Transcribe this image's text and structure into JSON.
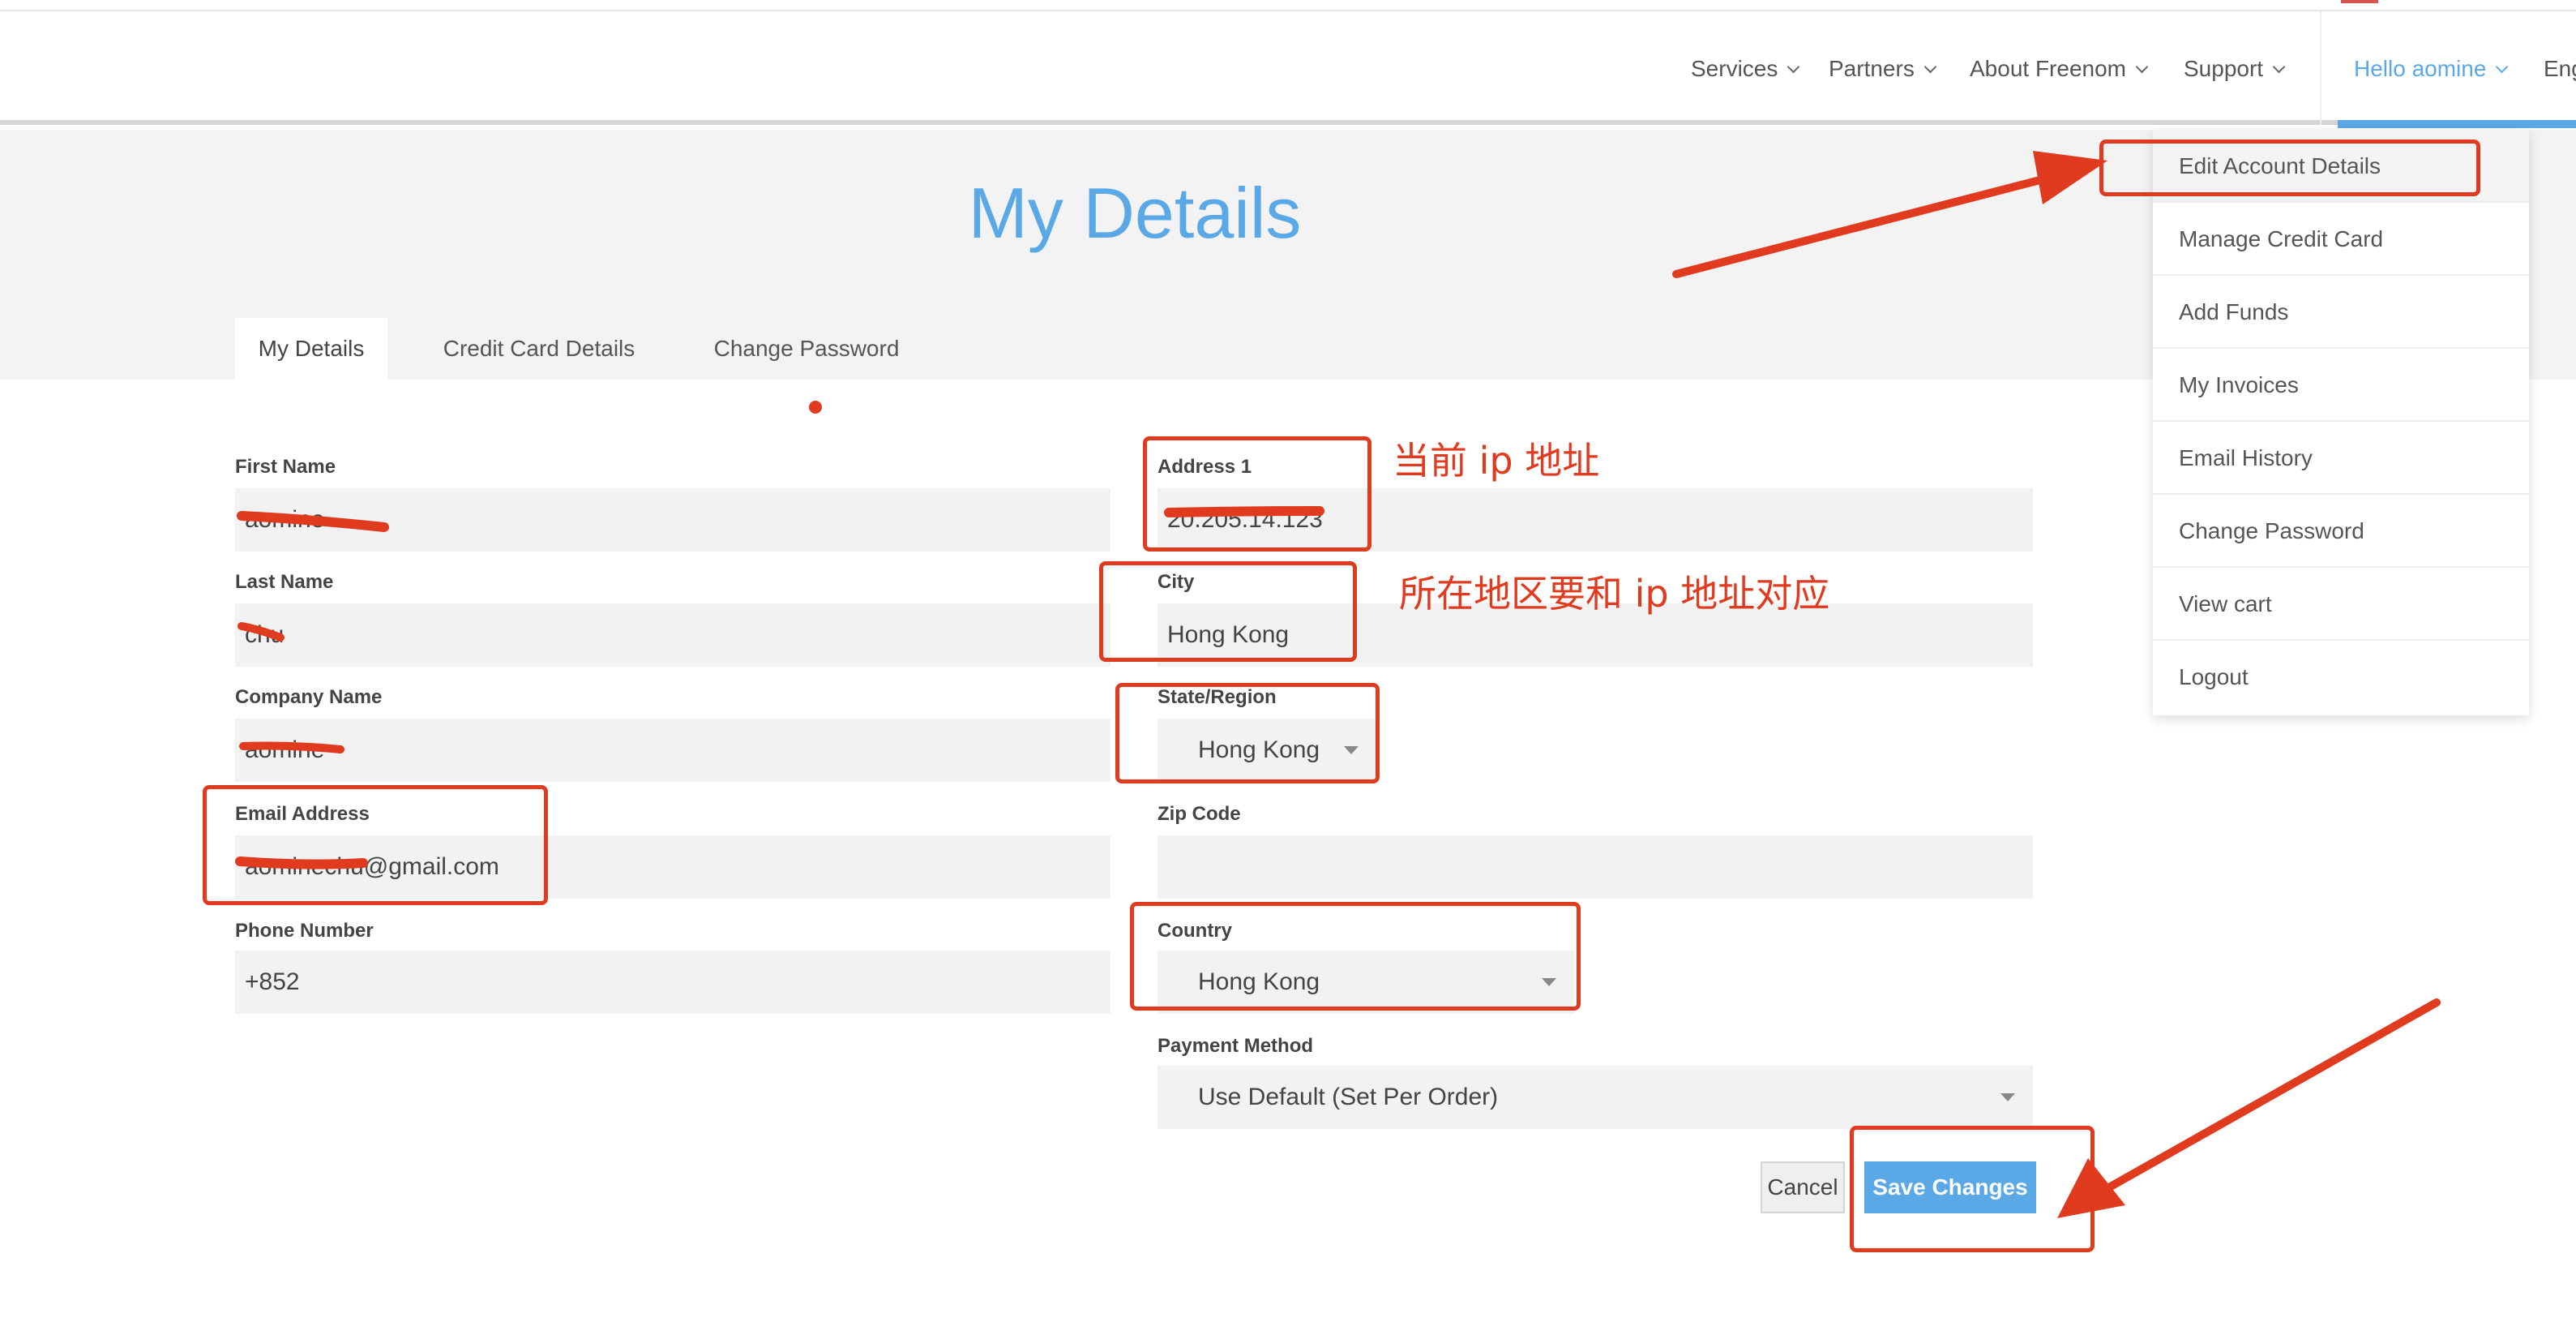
{
  "nav": {
    "services": "Services",
    "partners": "Partners",
    "about": "About Freenom",
    "support": "Support",
    "hello": "Hello aomine",
    "language": "Eng"
  },
  "page": {
    "title": "My Details",
    "tabs": [
      "My Details",
      "Credit Card Details",
      "Change Password"
    ]
  },
  "form": {
    "first_name": {
      "label": "First Name",
      "value": "aomine"
    },
    "last_name": {
      "label": "Last Name",
      "value": "chu"
    },
    "company": {
      "label": "Company Name",
      "value": "aomine"
    },
    "email": {
      "label": "Email Address",
      "value": "aominechu@gmail.com"
    },
    "phone": {
      "label": "Phone Number",
      "value": "+852"
    },
    "address1": {
      "label": "Address 1",
      "value": "20.205.14.123"
    },
    "city": {
      "label": "City",
      "value": "Hong Kong"
    },
    "state": {
      "label": "State/Region",
      "value": "Hong Kong"
    },
    "zip": {
      "label": "Zip Code",
      "value": ""
    },
    "country": {
      "label": "Country",
      "value": "Hong Kong"
    },
    "payment": {
      "label": "Payment Method",
      "value": "Use Default (Set Per Order)"
    },
    "cancel": "Cancel",
    "save": "Save Changes"
  },
  "dropdown": {
    "items": [
      "Edit Account Details",
      "Manage Credit Card",
      "Add Funds",
      "My Invoices",
      "Email History",
      "Change Password",
      "View cart",
      "Logout"
    ]
  },
  "annotations": {
    "ip_note": "当前 ip 地址",
    "region_note": "所在地区要和 ip 地址对应"
  },
  "colors": {
    "accent": "#5aa9e6",
    "annotation": "#e03a1f"
  }
}
